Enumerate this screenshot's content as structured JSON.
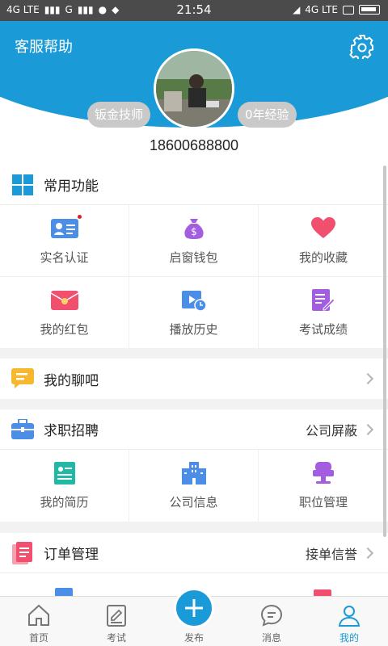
{
  "status": {
    "network_left": "4G LTE",
    "carrier2": "G",
    "time": "21:54",
    "network_right": "4G LTE"
  },
  "header": {
    "title": "客服帮助",
    "tag_left": "钣金技师",
    "tag_right": "0年经验",
    "phone": "18600688800"
  },
  "common": {
    "title": "常用功能",
    "items": [
      {
        "label": "实名认证",
        "icon": "id-card-icon"
      },
      {
        "label": "启窗钱包",
        "icon": "money-bag-icon"
      },
      {
        "label": "我的收藏",
        "icon": "heart-icon"
      },
      {
        "label": "我的红包",
        "icon": "red-envelope-icon"
      },
      {
        "label": "播放历史",
        "icon": "play-history-icon"
      },
      {
        "label": "考试成绩",
        "icon": "exam-score-icon"
      }
    ]
  },
  "chat": {
    "title": "我的聊吧"
  },
  "jobs": {
    "title": "求职招聘",
    "right": "公司屏蔽",
    "items": [
      {
        "label": "我的简历",
        "icon": "resume-icon"
      },
      {
        "label": "公司信息",
        "icon": "building-icon"
      },
      {
        "label": "职位管理",
        "icon": "position-icon"
      }
    ]
  },
  "orders": {
    "title": "订单管理",
    "right": "接单信誉"
  },
  "nav": {
    "items": [
      "首页",
      "考试",
      "发布",
      "消息",
      "我的"
    ]
  },
  "colors": {
    "primary": "#1a9ad6"
  }
}
